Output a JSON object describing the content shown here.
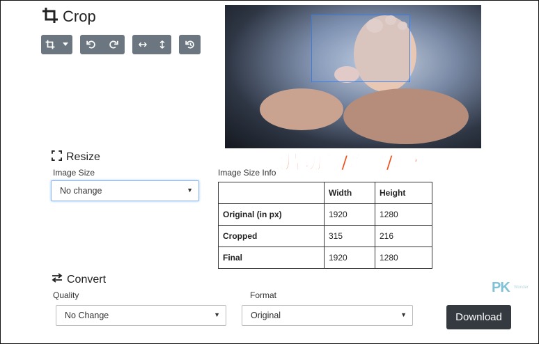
{
  "crop": {
    "title": "Crop",
    "toolbar": [
      "crop-options",
      "rotate-left",
      "rotate-right",
      "flip-horizontal",
      "flip-vertical",
      "reset"
    ]
  },
  "overlay": {
    "caption": "照片切割/旋轉/轉檔"
  },
  "resize": {
    "title": "Resize",
    "image_size_label": "Image Size",
    "image_size_value": "No change",
    "info_label": "Image Size Info",
    "table": {
      "headers": [
        "",
        "Width",
        "Height"
      ],
      "rows": [
        {
          "label": "Original (in px)",
          "width": "1920",
          "height": "1280"
        },
        {
          "label": "Cropped",
          "width": "315",
          "height": "216"
        },
        {
          "label": "Final",
          "width": "1920",
          "height": "1280"
        }
      ]
    }
  },
  "convert": {
    "title": "Convert",
    "quality_label": "Quality",
    "quality_value": "No Change",
    "format_label": "Format",
    "format_value": "Original",
    "download_label": "Download"
  },
  "watermark": {
    "text": "PK",
    "sub": "Wonder"
  },
  "colors": {
    "toolbar": "#6b7680",
    "download": "#343a40",
    "selection": "#3b7de0",
    "caption": "#f04a16"
  }
}
